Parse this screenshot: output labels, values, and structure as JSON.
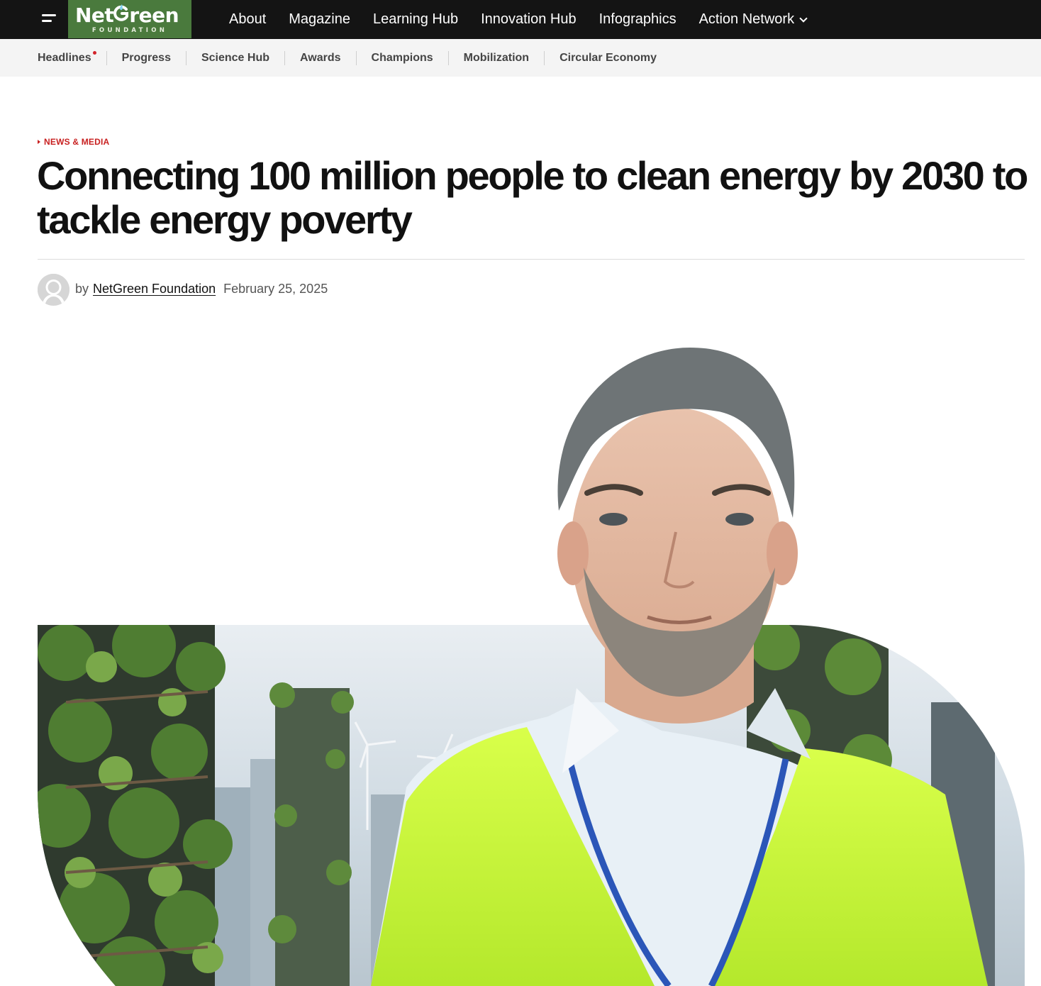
{
  "brand": {
    "name_part1": "Net",
    "name_part2": "reen",
    "tagline": "FOUNDATION"
  },
  "main_nav": {
    "items": [
      "About",
      "Magazine",
      "Learning Hub",
      "Innovation Hub",
      "Infographics",
      "Action Network"
    ]
  },
  "sub_nav": {
    "items": [
      "Headlines",
      "Progress",
      "Science Hub",
      "Awards",
      "Champions",
      "Mobilization",
      "Circular Economy"
    ]
  },
  "article": {
    "category": "NEWS & MEDIA",
    "title": "Connecting 100 million people to clean energy by 2030 to tackle energy poverty",
    "by_prefix": "by",
    "author": "NetGreen Foundation",
    "date": "February 25, 2025"
  },
  "colors": {
    "topbar": "#141414",
    "brand_green": "#4a7a3d",
    "accent_red": "#c82020",
    "vest_yellow": "#c8f23a"
  },
  "icons": {
    "menu": "hamburger-icon",
    "dropdown": "chevron-down-icon",
    "avatar": "user-avatar-icon"
  }
}
